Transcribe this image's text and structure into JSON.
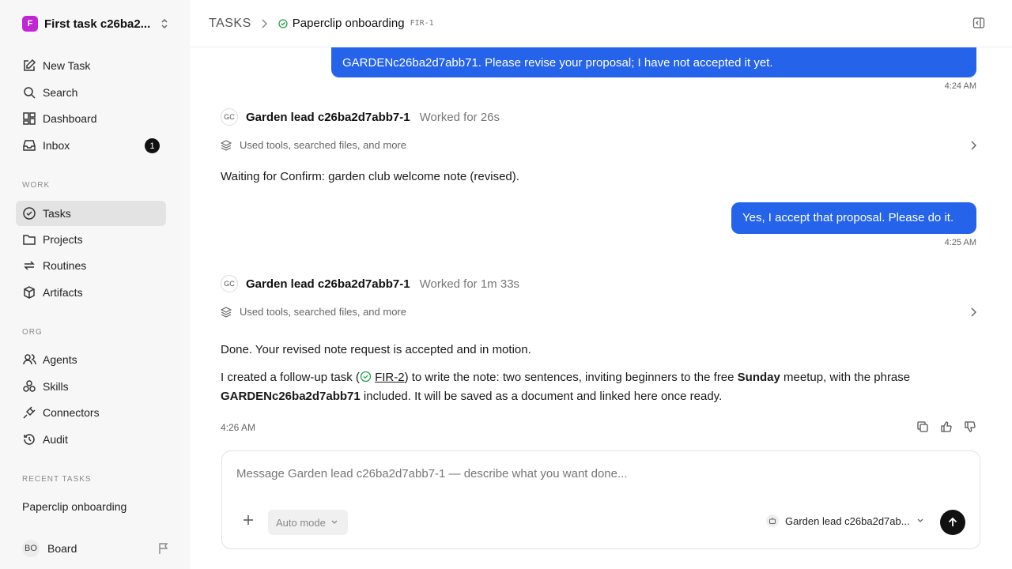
{
  "workspace": {
    "logo_letter": "F",
    "name": "First task c26ba2..."
  },
  "nav": {
    "new_task": "New Task",
    "search": "Search",
    "dashboard": "Dashboard",
    "inbox": "Inbox",
    "inbox_count": "1"
  },
  "sections": {
    "work": "WORK",
    "org": "ORG",
    "recent": "RECENT TASKS"
  },
  "work_items": {
    "tasks": "Tasks",
    "projects": "Projects",
    "routines": "Routines",
    "artifacts": "Artifacts"
  },
  "org_items": {
    "agents": "Agents",
    "skills": "Skills",
    "connectors": "Connectors",
    "audit": "Audit"
  },
  "recent_tasks": [
    "Paperclip onboarding"
  ],
  "board": {
    "initials": "BO",
    "label": "Board"
  },
  "header": {
    "root": "TASKS",
    "title": "Paperclip onboarding",
    "id": "FIR-1"
  },
  "thread": {
    "user_msg_1_line1": "GARDENc26ba2d7abb71. Please revise your proposal; I have not accepted it yet.",
    "user_msg_1_time": "4:24 AM",
    "agent_run_1": {
      "initials": "GC",
      "name": "Garden lead c26ba2d7abb7-1",
      "duration": "Worked for 26s",
      "tools": "Used tools, searched files, and more",
      "text": "Waiting for Confirm: garden club welcome note (revised)."
    },
    "user_msg_2": "Yes, I accept that proposal. Please do it.",
    "user_msg_2_time": "4:25 AM",
    "agent_run_2": {
      "initials": "GC",
      "name": "Garden lead c26ba2d7abb7-1",
      "duration": "Worked for 1m 33s",
      "tools": "Used tools, searched files, and more",
      "para1": "Done. Your revised note request is accepted and in motion.",
      "para2_a": "I created a follow-up task (",
      "para2_link": "FIR-2",
      "para2_b": ") to write the note: two sentences, inviting beginners to the free ",
      "para2_bold1": "Sunday",
      "para2_c": " meetup, with the phrase ",
      "para2_bold2": "GARDENc26ba2d7abb71",
      "para2_d": " included. It will be saved as a document and linked here once ready.",
      "time": "4:26 AM"
    }
  },
  "composer": {
    "placeholder": "Message Garden lead c26ba2d7abb7-1 — describe what you want done...",
    "mode": "Auto mode",
    "agent": "Garden lead c26ba2d7ab..."
  }
}
